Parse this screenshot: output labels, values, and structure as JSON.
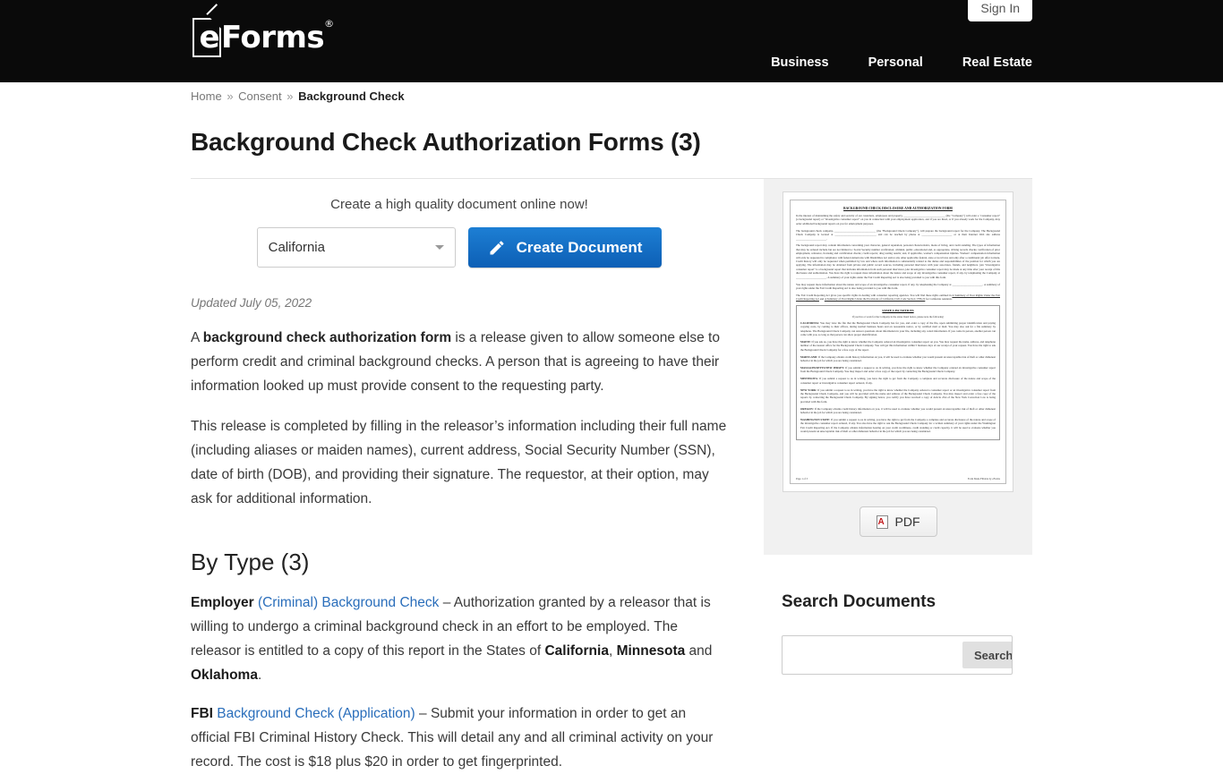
{
  "header": {
    "signin_label": "Sign In",
    "logo_e": "e",
    "logo_text": "Forms",
    "logo_reg": "®",
    "nav": [
      {
        "label": "Business"
      },
      {
        "label": "Personal"
      },
      {
        "label": "Real Estate"
      }
    ]
  },
  "breadcrumb": {
    "home": "Home",
    "sep1": "»",
    "parent": "Consent",
    "sep2": "»",
    "current": "Background Check"
  },
  "page": {
    "title": "Background Check Authorization Forms (3)",
    "updated": "Updated July 05, 2022"
  },
  "cta": {
    "label": "Create a high quality document online now!",
    "state_value": "California",
    "button_label": "Create Document"
  },
  "intro": {
    "p1_a": "A ",
    "p1_b": "background check authorization form",
    "p1_c": " is a release given to allow someone else to perform credit and criminal background checks. A person that is agreeing to have their information looked up must provide consent to the requesting party.",
    "p2": "This release is completed by filling in the releasor’s information including their full name (including aliases or maiden names), current address, Social Security Number (SSN), date of birth (DOB), and providing their signature. The requestor, at their option, may ask for additional information."
  },
  "bytype": {
    "heading": "By Type (3)",
    "items": [
      {
        "link_bold": "Employer",
        "link_rest": " (Criminal) Background Check",
        "dash": " – ",
        "desc_a": "Authorization granted by a releasor that is willing to undergo a criminal background check in an effort to be employed. The releasor is entitled to a copy of this report in the States of ",
        "state1": "California",
        "comma": ", ",
        "state2": "Minnesota",
        "and": " and ",
        "state3": "Oklahoma",
        "period": "."
      },
      {
        "link_bold": "FBI",
        "link_rest": " Background Check (Application)",
        "dash": " – ",
        "desc_a": "Submit your information in order to get an official FBI Criminal History Check. This will detail any and all criminal activity on your record. The cost is $18 plus $20 in order to get fingerprinted."
      }
    ]
  },
  "sidebar": {
    "pdf_label": "PDF",
    "search_heading": "Search Documents",
    "search_value": "",
    "search_placeholder": "",
    "search_button": "Search"
  },
  "doc_preview": {
    "title": "BACKGROUND CHECK DISCLOSURE AND AUTHORIZATION FORM",
    "p1": "In the interest of maintaining the safety and security of our customers, employees and property, ______________________________ (the \"Company\") will order a \"consumer report\" (a background report) or \"investigative consumer report\" on you in connection with your employment application, and if you are hired, or if you already work for the Company, may order additional background reports on you for employment purposes.",
    "p2": "The background check company, ______________________________ (the \"Background Check Company\"), will prepare the background report for the Company. The Background Check Company is located at ______________________________ and can be reached by phone at ______________________ or at their Internet Web site address ______________________.",
    "p3": "The background report may contain information concerning your character, general reputation, personal characteristics, mode of living, and credit standing. The types of information that may be ordered include but are not limited to: Social Security number verification; criminal, public, educational and, as appropriate, driving records checks; verification of prior employment, reference, licensing and certification checks; credit reports; drug testing results; and, if applicable, worker's compensation injuries. Workers' compensation information will only be requested in compliance with federal Americans with Disabilities Act and/or any other applicable federal, state or local laws and only after a conditional job offer is made. Credit history will only be requested when permitted by law and where such information is substantially related to the duties and responsibilities of the position for which you are applying. The information may be obtained from private and public record sources, including personal interviews with your associates, friends, and neighbors. (An \"investigative consumer report\" is a background report that includes information from such personal interviews.) An investigative consumer report may be made at any time after your receipt of this disclosure and authorization. You have the right to request more information about the nature and scope of any investigative consumer report, if any, by telephoning the Company at ______________________. A summary of your rights under the Fair Credit Reporting Act is also being provided to you with this form.",
    "p4": "You may request more information about the nature and scope of an investigative consumer report, if any, by telephoning the Company at ______________________. A summary of your rights under the Fair Credit Reporting Act is also being provided to you with this form.",
    "p5": "The Fair Credit Reporting Act gives you specific rights in dealing with consumer reporting agencies. You will find these rights outlined in",
    "p5_link1": "A Summary of Your Rights Under the Fair Credit Reporting Act",
    "p5_mid": "and",
    "p5_link2": "A Summary of Your Rights Under the Provisions of California Civil Code Section 1786.22",
    "p5_end": "for California residents.",
    "notices_heading": "STATE LAW NOTICES",
    "notices_intro": "If you live or work for the Company in the states listed below, please note the following:",
    "notices": [
      {
        "state": "CALIFORNIA:",
        "text": " You may view the file that the Background Check Company has for you, and order a copy of the file, upon submitting proper identification and paying copying costs, by coming to their offices, during normal business hours and on reasonable notice, or by certified mail or mail. You may also ask for a file summary by telephone. The Background Check Company can answer questions about information in your file, including any coded information. If you come in person, another person can come with you, so long as that person can show proper identification."
      },
      {
        "state": "MAINE:",
        "text": " If you ask us, you have the right to know whether the Company ordered an investigative consumer report on you. You may request the name, address, and telephone number of the nearest office for the Background Check Company. You will get this information within 5 business days of our receipt of your request. You have the right to ask the Background Check Company for a free copy of the report."
      },
      {
        "state": "MARYLAND:",
        "text": " If the Company obtains credit history information on you, it will be used to evaluate whether you would present an unacceptable risk of theft or other dishonest behavior in the job for which you are being considered."
      },
      {
        "state": "MASSACHUSETTS/NEW JERSEY:",
        "text": " If you submit a request to us in writing, you have the right to know whether the Company ordered an investigative consumer report from the Background Check Company. You may inspect and order a free copy of the report by contacting the Background Check Company."
      },
      {
        "state": "MINNESOTA:",
        "text": " If you submit a request to us in writing, you have the right to get from the Company a complete and accurate disclosure of the nature and scope of the consumer report or investigative consumer report ordered, if any."
      },
      {
        "state": "NEW YORK:",
        "text": " If you submit a request to us in writing, you have the right to know whether the Company ordered a consumer report or an investigative consumer report from the Background Check Company, and you will be provided with the name and address of the Background Check Company. You may inspect and order a free copy of the reports by contacting the Background Check Company. By signing below, you certify you have received a copy of Article 23A of the New York Correction Law is being provided with this form."
      },
      {
        "state": "OREGON:",
        "text": " If the Company obtains credit history information on you, it will be used to evaluate whether you would present an unacceptable risk of theft or other dishonest behavior in the job for which you are being considered."
      },
      {
        "state": "WASHINGTON STATE:",
        "text": " If you submit a request to us in writing, you have the right to get from the Company a complete and accurate disclosure of the nature and scope of the investigative consumer report ordered, if any. You also have the right to ask the Background Check Company for a written summary of your rights under the Washington Fair Credit Reporting Act. If the Company obtains information bearing on your credit worthiness, credit standing or credit capacity, it will be used to evaluate whether you would present an unacceptable risk of theft or other dishonest behavior in the job for which you are being considered."
      }
    ],
    "footer_left": "Page 1 of 3",
    "footer_right": "Form Made Fillable by eForms"
  }
}
